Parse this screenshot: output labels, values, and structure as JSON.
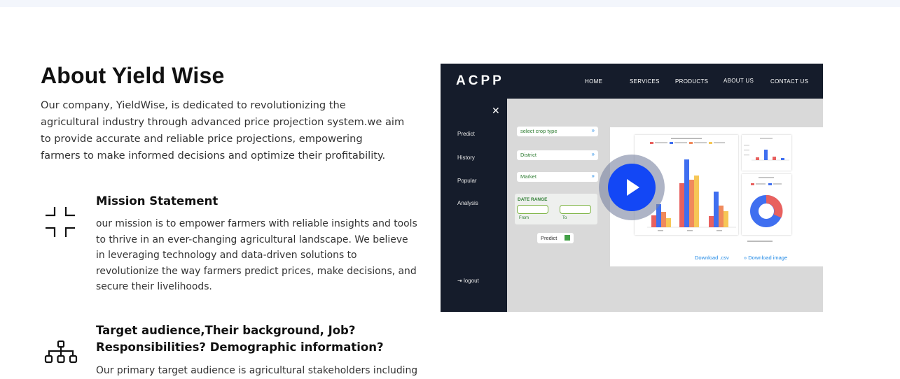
{
  "about": {
    "title": "About Yield Wise",
    "intro": "Our company, YieldWise, is dedicated to revolutionizing the agricultural industry through advanced price projection system.we aim to provide accurate and reliable price projections, empowering farmers to make informed decisions and optimize their profitability."
  },
  "features": [
    {
      "icon": "collapse-arrows-icon",
      "title": "Mission Statement",
      "text": "our mission is to empower farmers with reliable insights and tools to thrive in an ever-changing agricultural landscape. We believe in leveraging technology and data-driven solutions to revolutionize the way farmers predict prices, make decisions, and secure their livelihoods."
    },
    {
      "icon": "org-hierarchy-icon",
      "title": "Target audience,Their background, Job? Responsibilities? Demographic information?",
      "text": "Our primary target audience is agricultural stakeholders including"
    }
  ],
  "video": {
    "brand": "ACPP",
    "nav": [
      "HOME",
      "SERVICES",
      "PRODUCTS",
      "ABOUT US",
      "CONTACT US"
    ],
    "sidebar": [
      "Predict",
      "History",
      "Popular",
      "Analysis"
    ],
    "logout": "logout",
    "selects": [
      "select crop type",
      "District",
      "Market"
    ],
    "date_range_label": "DATE RANGE",
    "from_label": "From",
    "to_label": "To",
    "predict_button": "Predict",
    "download_csv": "Download .csv",
    "download_image": "Download image",
    "play_icon": "play-icon",
    "colors": {
      "nav_bg": "#151c2b",
      "play": "#1347f5",
      "bar_red": "#e8615f",
      "bar_blue": "#3f6ff0",
      "bar_orange": "#f08a5c",
      "bar_yellow": "#f6c757"
    }
  }
}
